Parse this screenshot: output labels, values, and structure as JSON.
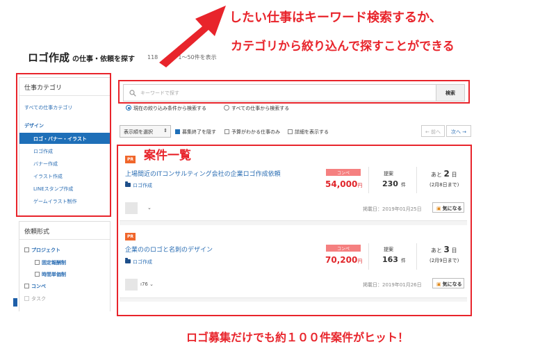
{
  "header": {
    "title": "ロゴ作成",
    "title_sub": "の仕事・依頼を探す",
    "count": "118",
    "count_tail": "3、1〜50件を表示"
  },
  "sidebar": {
    "category_heading": "仕事カテゴリ",
    "all_categories": "すべての仕事カテゴリ",
    "group": "デザイン",
    "active": "ロゴ・バナー・イラスト",
    "items": [
      "ロゴ作成",
      "バナー作成",
      "イラスト作成",
      "LINEスタンプ作成",
      "ゲームイラスト制作"
    ],
    "type_heading": "依頼形式",
    "types": [
      "プロジェクト",
      "固定報酬制",
      "時間単価制",
      "コンペ",
      "タスク"
    ]
  },
  "search": {
    "placeholder": "キーワードで探す",
    "button": "検索",
    "radio_current": "現在の絞り込み条件から検索する",
    "radio_all": "すべての仕事から検索する"
  },
  "toolbar": {
    "sort": "表示順を選択",
    "sort_arrow": "⇕",
    "filter_hide_closed": "募集終了を隠す",
    "filter_budget": "予算がわかる仕事のみ",
    "filter_details": "詳細を表示する",
    "prev": "← 前へ",
    "next": "次へ →"
  },
  "listings": [
    {
      "badge": "PR",
      "title": "上場間近のITコンサルティング会社の企業ロゴ作成依頼",
      "category": "ロゴ作成",
      "type": "コンペ",
      "price": "54,000",
      "price_unit": "円",
      "proposals_label": "提案",
      "proposals": "230",
      "proposals_unit": "件",
      "days_prefix": "あと",
      "days": "2",
      "days_unit": "日",
      "deadline": "(2月8日まで)",
      "user": "",
      "posted": "掲載日：2019年01月25日",
      "fav": "気になる"
    },
    {
      "badge": "PR",
      "title": "企業ののロゴと名刺のデザイン",
      "category": "ロゴ作成",
      "type": "コンペ",
      "price": "70,200",
      "price_unit": "円",
      "proposals_label": "提案",
      "proposals": "163",
      "proposals_unit": "件",
      "days_prefix": "あと",
      "days": "3",
      "days_unit": "日",
      "deadline": "(2月9日まで)",
      "user": "ı76",
      "posted": "掲載日：2019年01月26日",
      "fav": "気になる"
    }
  ],
  "annotations": {
    "top_line1": "したい仕事はキーワード検索するか、",
    "top_line2": "カテゴリから絞り込んで探すことができる",
    "list_label": "案件一覧",
    "bottom": "ロゴ募集だけでも約１００件案件がヒット！"
  },
  "colors": {
    "accent_red": "#e8242b",
    "link_blue": "#2a6db3",
    "active_blue": "#1e6fb8",
    "pr_orange": "#f0662b",
    "price_red": "#e0262b"
  }
}
